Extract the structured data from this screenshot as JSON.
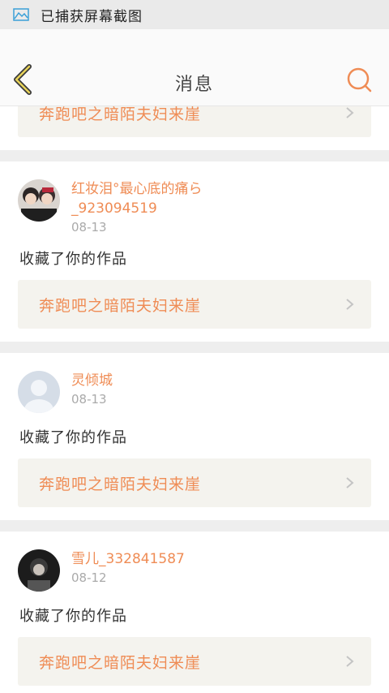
{
  "status_bar": {
    "icon": "image-icon",
    "text": "已捕获屏幕截图"
  },
  "nav": {
    "title": "消息",
    "back_icon": "chevron-left-icon",
    "search_icon": "search-icon",
    "accent": "#ef8c55"
  },
  "link_card_text": "奔跑吧之暗陌夫妇来崖",
  "messages": [
    {
      "name": "红妆泪°最心底的痛ら_923094519",
      "time": "08-13",
      "action": "收藏了你的作品",
      "link": "奔跑吧之暗陌夫妇来崖",
      "avatar": "photo-avatar"
    },
    {
      "name": "灵倾城",
      "time": "08-13",
      "action": "收藏了你的作品",
      "link": "奔跑吧之暗陌夫妇来崖",
      "avatar": "default-avatar"
    },
    {
      "name": "雪儿_332841587",
      "time": "08-12",
      "action": "收藏了你的作品",
      "link": "奔跑吧之暗陌夫妇来崖",
      "avatar": "photo-avatar"
    }
  ]
}
